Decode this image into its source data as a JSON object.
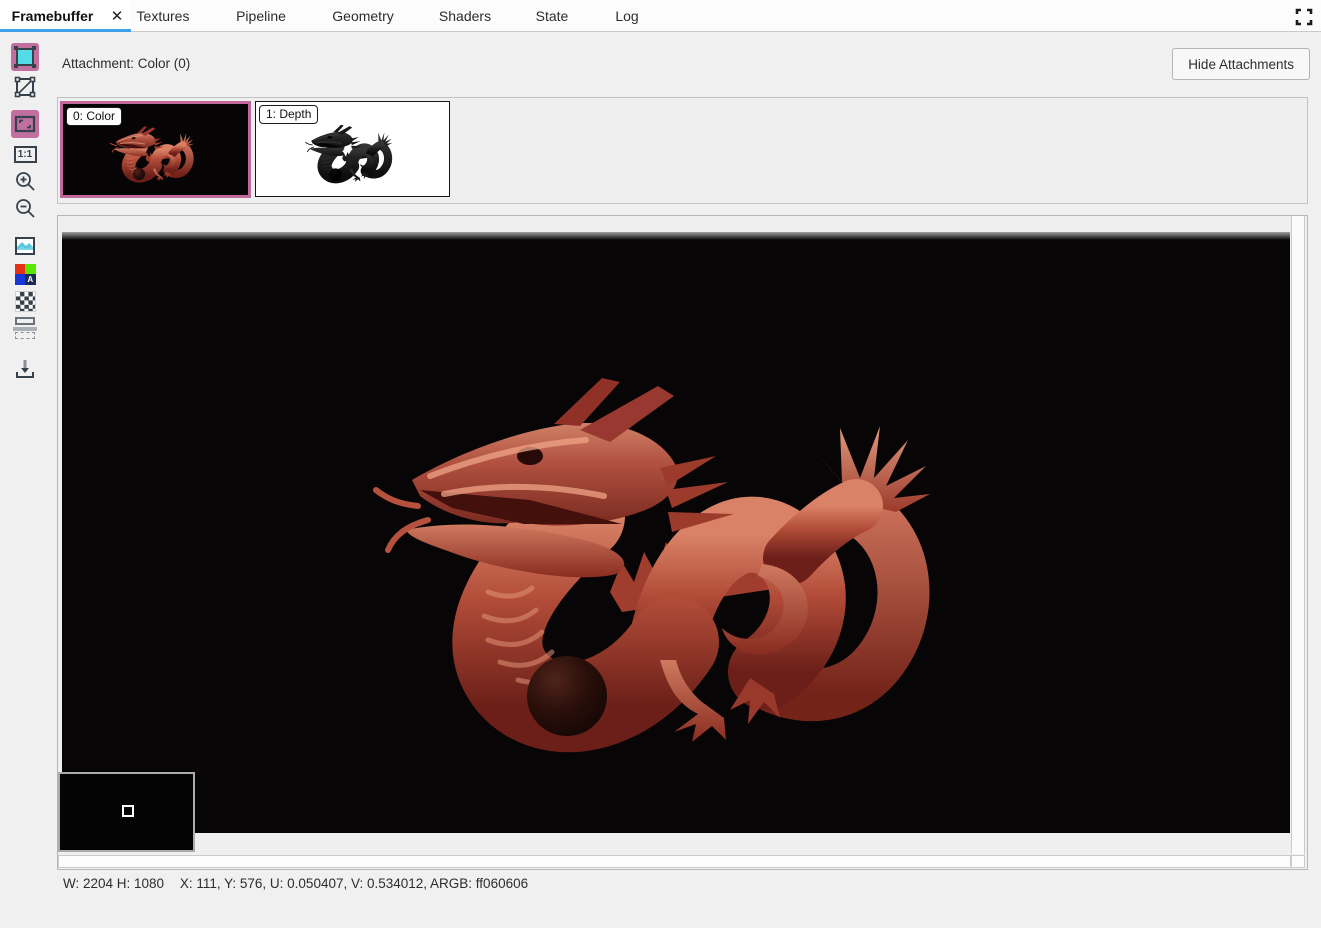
{
  "colors": {
    "accent_blue": "#3da0e8",
    "selection_pink": "#c2699c",
    "color_attachment_bg": "#000000",
    "depth_attachment_bg": "#ffffff",
    "picked_argb": "ff060606"
  },
  "tab_bar": {
    "close_glyph": "✕",
    "tabs": [
      {
        "label": "Framebuffer",
        "active": true
      },
      {
        "label": "Textures",
        "active": false
      },
      {
        "label": "Pipeline",
        "active": false
      },
      {
        "label": "Geometry",
        "active": false
      },
      {
        "label": "Shaders",
        "active": false
      },
      {
        "label": "State",
        "active": false
      },
      {
        "label": "Log",
        "active": false
      }
    ]
  },
  "toolbar": {
    "actual_size_label": "1:1",
    "rgba_a_label": "A",
    "buttons": [
      {
        "name": "texture-view",
        "active": true
      },
      {
        "name": "wireframe",
        "active": false
      },
      {
        "name": "fit-to-window",
        "active": true
      },
      {
        "name": "actual-size",
        "active": false
      },
      {
        "name": "zoom-in",
        "active": false
      },
      {
        "name": "zoom-out",
        "active": false
      },
      {
        "name": "image-overlay",
        "active": false
      },
      {
        "name": "rgba-channels",
        "active": false
      },
      {
        "name": "alpha-checkerboard",
        "active": false
      },
      {
        "name": "range-control",
        "active": false
      },
      {
        "name": "save-texture",
        "active": false
      }
    ]
  },
  "attachment_bar": {
    "label": "Attachment: Color (0)",
    "hide_button_label": "Hide Attachments"
  },
  "attachments": [
    {
      "label": "0: Color",
      "selected": true,
      "type": "color"
    },
    {
      "label": "1: Depth",
      "selected": false,
      "type": "depth"
    }
  ],
  "status_bar": {
    "dimensions": "W: 2204 H: 1080",
    "pixel_info": "X: 111, Y: 576, U: 0.050407, V: 0.534012, ARGB: ff060606"
  }
}
